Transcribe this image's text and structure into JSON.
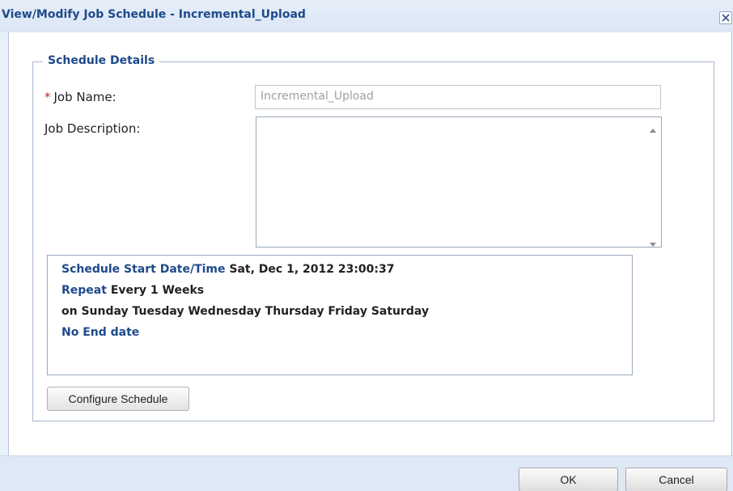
{
  "dialog": {
    "title": "View/Modify Job Schedule - Incremental_Upload",
    "close_icon": "close-icon"
  },
  "schedule_details": {
    "legend": "Schedule Details",
    "job_name_label": "Job Name:",
    "required_marker": "*",
    "job_name_value": "Incremental_Upload",
    "job_description_label": "Job Description:",
    "job_description_value": ""
  },
  "summary": {
    "start_label": "Schedule Start Date/Time",
    "start_value": "Sat, Dec 1, 2012 23:00:37",
    "repeat_label": "Repeat",
    "repeat_value": "Every 1 Weeks",
    "days_text": "on Sunday Tuesday Wednesday Thursday Friday Saturday",
    "end_text": "No End date"
  },
  "buttons": {
    "configure_schedule": "Configure Schedule",
    "ok": "OK",
    "cancel": "Cancel"
  },
  "colors": {
    "title_blue": "#1e4a8a",
    "required_red": "#e02020",
    "dialog_background": "#e9f0fa"
  }
}
